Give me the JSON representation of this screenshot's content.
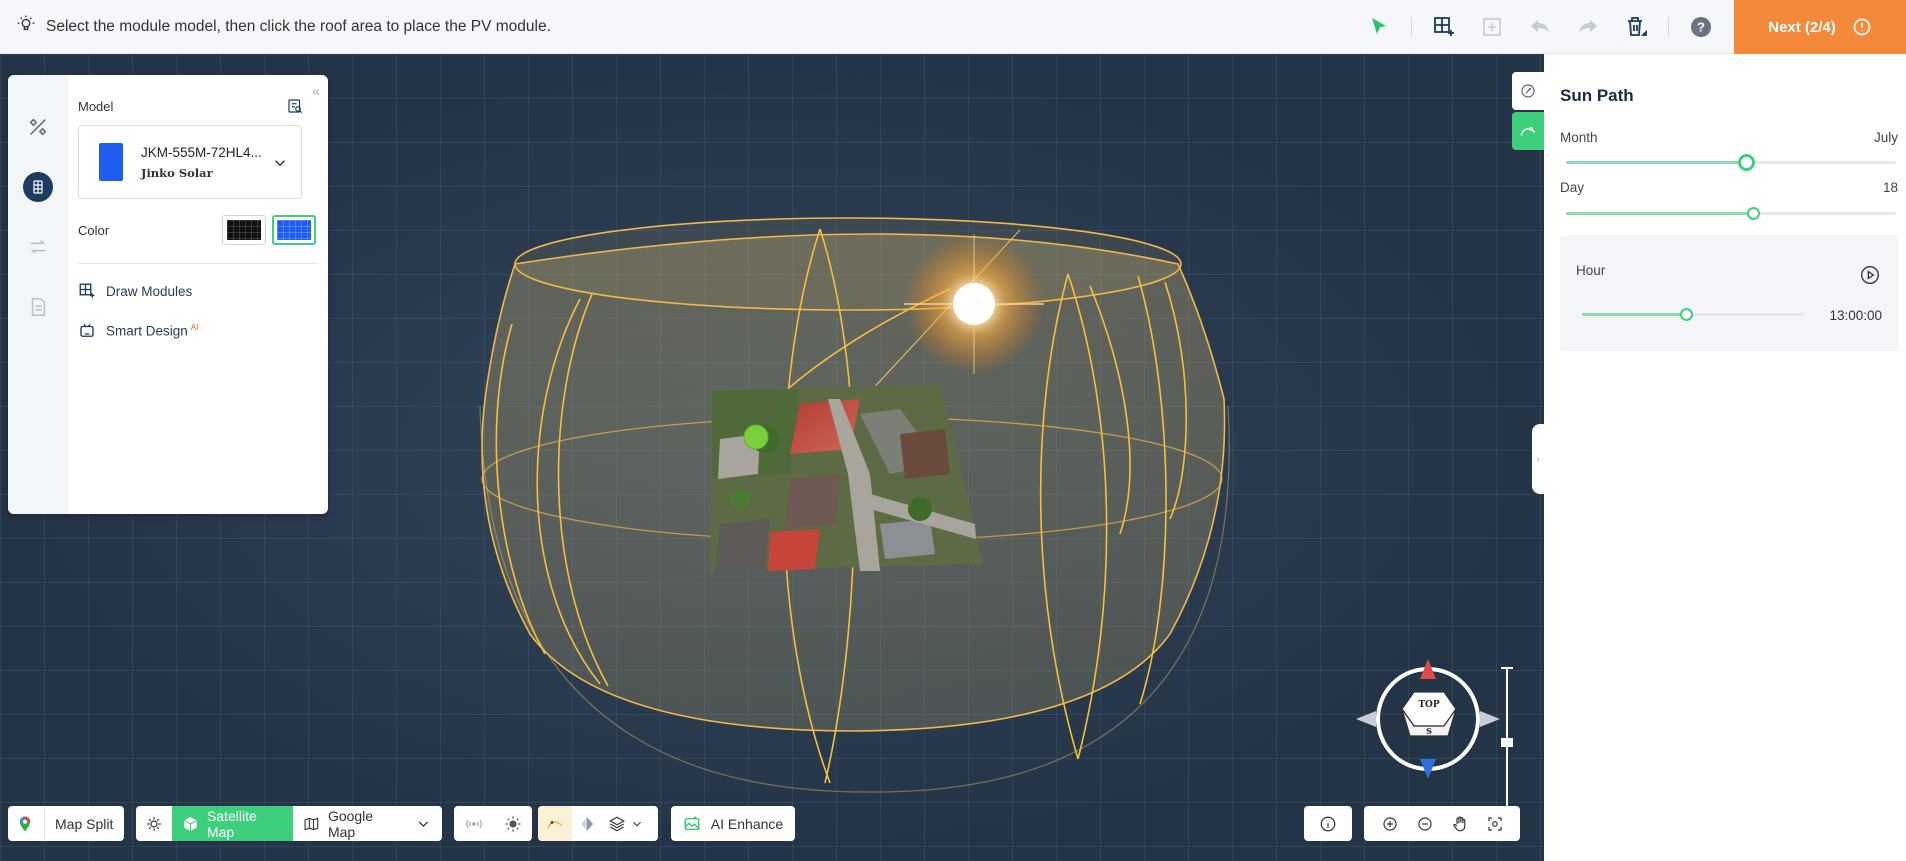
{
  "topbar": {
    "hint": "Select the module model, then click the roof area to place the PV module.",
    "tools": [
      "select-tool",
      "draw-modules-tool",
      "add-tool",
      "undo",
      "redo",
      "delete",
      "help"
    ],
    "next_label": "Next (2/4)"
  },
  "left_panel": {
    "model_label": "Model",
    "model_name": "JKM-555M-72HL4...",
    "model_brand": "Jinko Solar",
    "color_label": "Color",
    "colors": [
      "#111111",
      "#1f5cf0"
    ],
    "selected_color": "#1f5cf0",
    "actions": {
      "draw_modules": "Draw Modules",
      "smart_design": "Smart Design",
      "smart_design_badge": "AI"
    }
  },
  "right_panel": {
    "title": "Sun Path",
    "month": {
      "label": "Month",
      "value": "July",
      "fraction": 0.545
    },
    "day": {
      "label": "Day",
      "value": "18",
      "fraction": 0.567
    },
    "hour": {
      "label": "Hour",
      "value": "13:00:00",
      "fraction": 0.47
    }
  },
  "bottom_bar": {
    "map_split": "Map Split",
    "satellite_map": "Satellite Map",
    "google_map": "Google Map",
    "ai_enhance": "AI Enhance"
  },
  "compass": {
    "top_label": "TOP",
    "south_label": "S"
  },
  "colors": {
    "accent": "#3ecf7c",
    "next": "#f5893b",
    "sun_path": "#f0b84a",
    "brand_dark": "#1b2a45"
  }
}
